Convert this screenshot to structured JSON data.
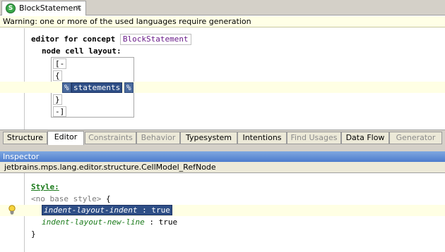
{
  "file_tab": {
    "title": "BlockStatement",
    "icon_letter": "S",
    "close_glyph": "×"
  },
  "warning": "Warning: one or more of the used languages require generation",
  "editor": {
    "editor_for_concept": "editor for concept",
    "concept_name": "BlockStatement",
    "node_cell_layout": "node cell layout:",
    "cells": {
      "open_collection": "[-",
      "open_brace": "{",
      "ref_prefix": "%",
      "ref_name": "statements",
      "ref_suffix": "%",
      "close_brace": "}",
      "close_collection": "-]"
    }
  },
  "aspect_tabs": [
    {
      "label": "Structure",
      "state": "enabled"
    },
    {
      "label": "Editor",
      "state": "active"
    },
    {
      "label": "Constraints",
      "state": "disabled"
    },
    {
      "label": "Behavior",
      "state": "disabled"
    },
    {
      "label": "Typesystem",
      "state": "enabled"
    },
    {
      "label": "Intentions",
      "state": "enabled"
    },
    {
      "label": "Find Usages",
      "state": "disabled"
    },
    {
      "label": "Data Flow",
      "state": "enabled"
    },
    {
      "label": "Generator",
      "state": "disabled"
    }
  ],
  "inspector": {
    "title": "Inspector",
    "node_path": "jetbrains.mps.lang.editor.structure.CellModel_RefNode",
    "style_label": "Style:",
    "base_style": "<no base style>",
    "open_brace": "{",
    "items": [
      {
        "name": "indent-layout-indent",
        "separator": ":",
        "value": "true"
      },
      {
        "name": "indent-layout-new-line",
        "separator": ":",
        "value": "true"
      }
    ],
    "close_brace": "}"
  },
  "colors": {
    "selection": "#2e4e86",
    "keyword_green": "#1a7a1a",
    "concept_purple": "#6a1d8a",
    "highlight_line": "#ffffe4",
    "inspector_title": "#4d7ccd"
  }
}
